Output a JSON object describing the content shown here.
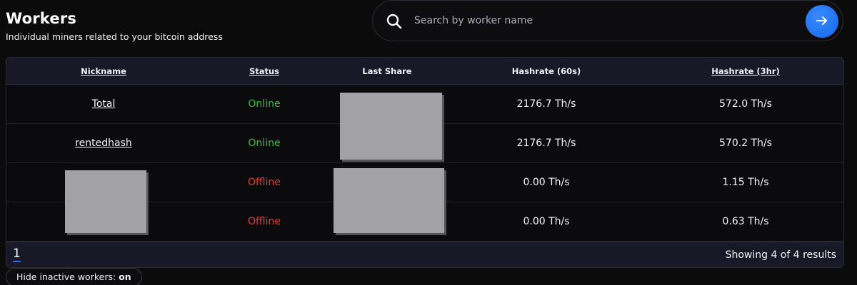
{
  "header": {
    "title": "Workers",
    "subtitle": "Individual miners related to your bitcoin address"
  },
  "search": {
    "placeholder": "Search by worker name",
    "value": "",
    "icon": "search-icon",
    "submit_icon": "arrow-right-icon",
    "submit_color": "#1f74f5"
  },
  "table": {
    "columns": [
      {
        "label": "Nickname",
        "sortable": true
      },
      {
        "label": "Status",
        "sortable": true
      },
      {
        "label": "Last Share",
        "sortable": false
      },
      {
        "label": "Hashrate (60s)",
        "sortable": false
      },
      {
        "label": "Hashrate (3hr)",
        "sortable": true
      }
    ],
    "rows": [
      {
        "nickname": "Total",
        "status": "Online",
        "last_share": "",
        "hashrate_60s": "2176.7 Th/s",
        "hashrate_3hr": "572.0 Th/s"
      },
      {
        "nickname": "rentedhash",
        "status": "Online",
        "last_share": "",
        "hashrate_60s": "2176.7 Th/s",
        "hashrate_3hr": "570.2 Th/s"
      },
      {
        "nickname": "",
        "status": "Offline",
        "last_share": "",
        "hashrate_60s": "0.00 Th/s",
        "hashrate_3hr": "1.15 Th/s"
      },
      {
        "nickname": "",
        "status": "Offline",
        "last_share": "",
        "hashrate_60s": "0.00 Th/s",
        "hashrate_3hr": "0.63 Th/s"
      }
    ],
    "colors": {
      "online": "#3bbf3f",
      "offline": "#e0403a"
    }
  },
  "pagination": {
    "current_page": "1",
    "results_text": "Showing 4 of 4 results"
  },
  "filter": {
    "label": "Hide inactive workers:",
    "value": "on"
  }
}
